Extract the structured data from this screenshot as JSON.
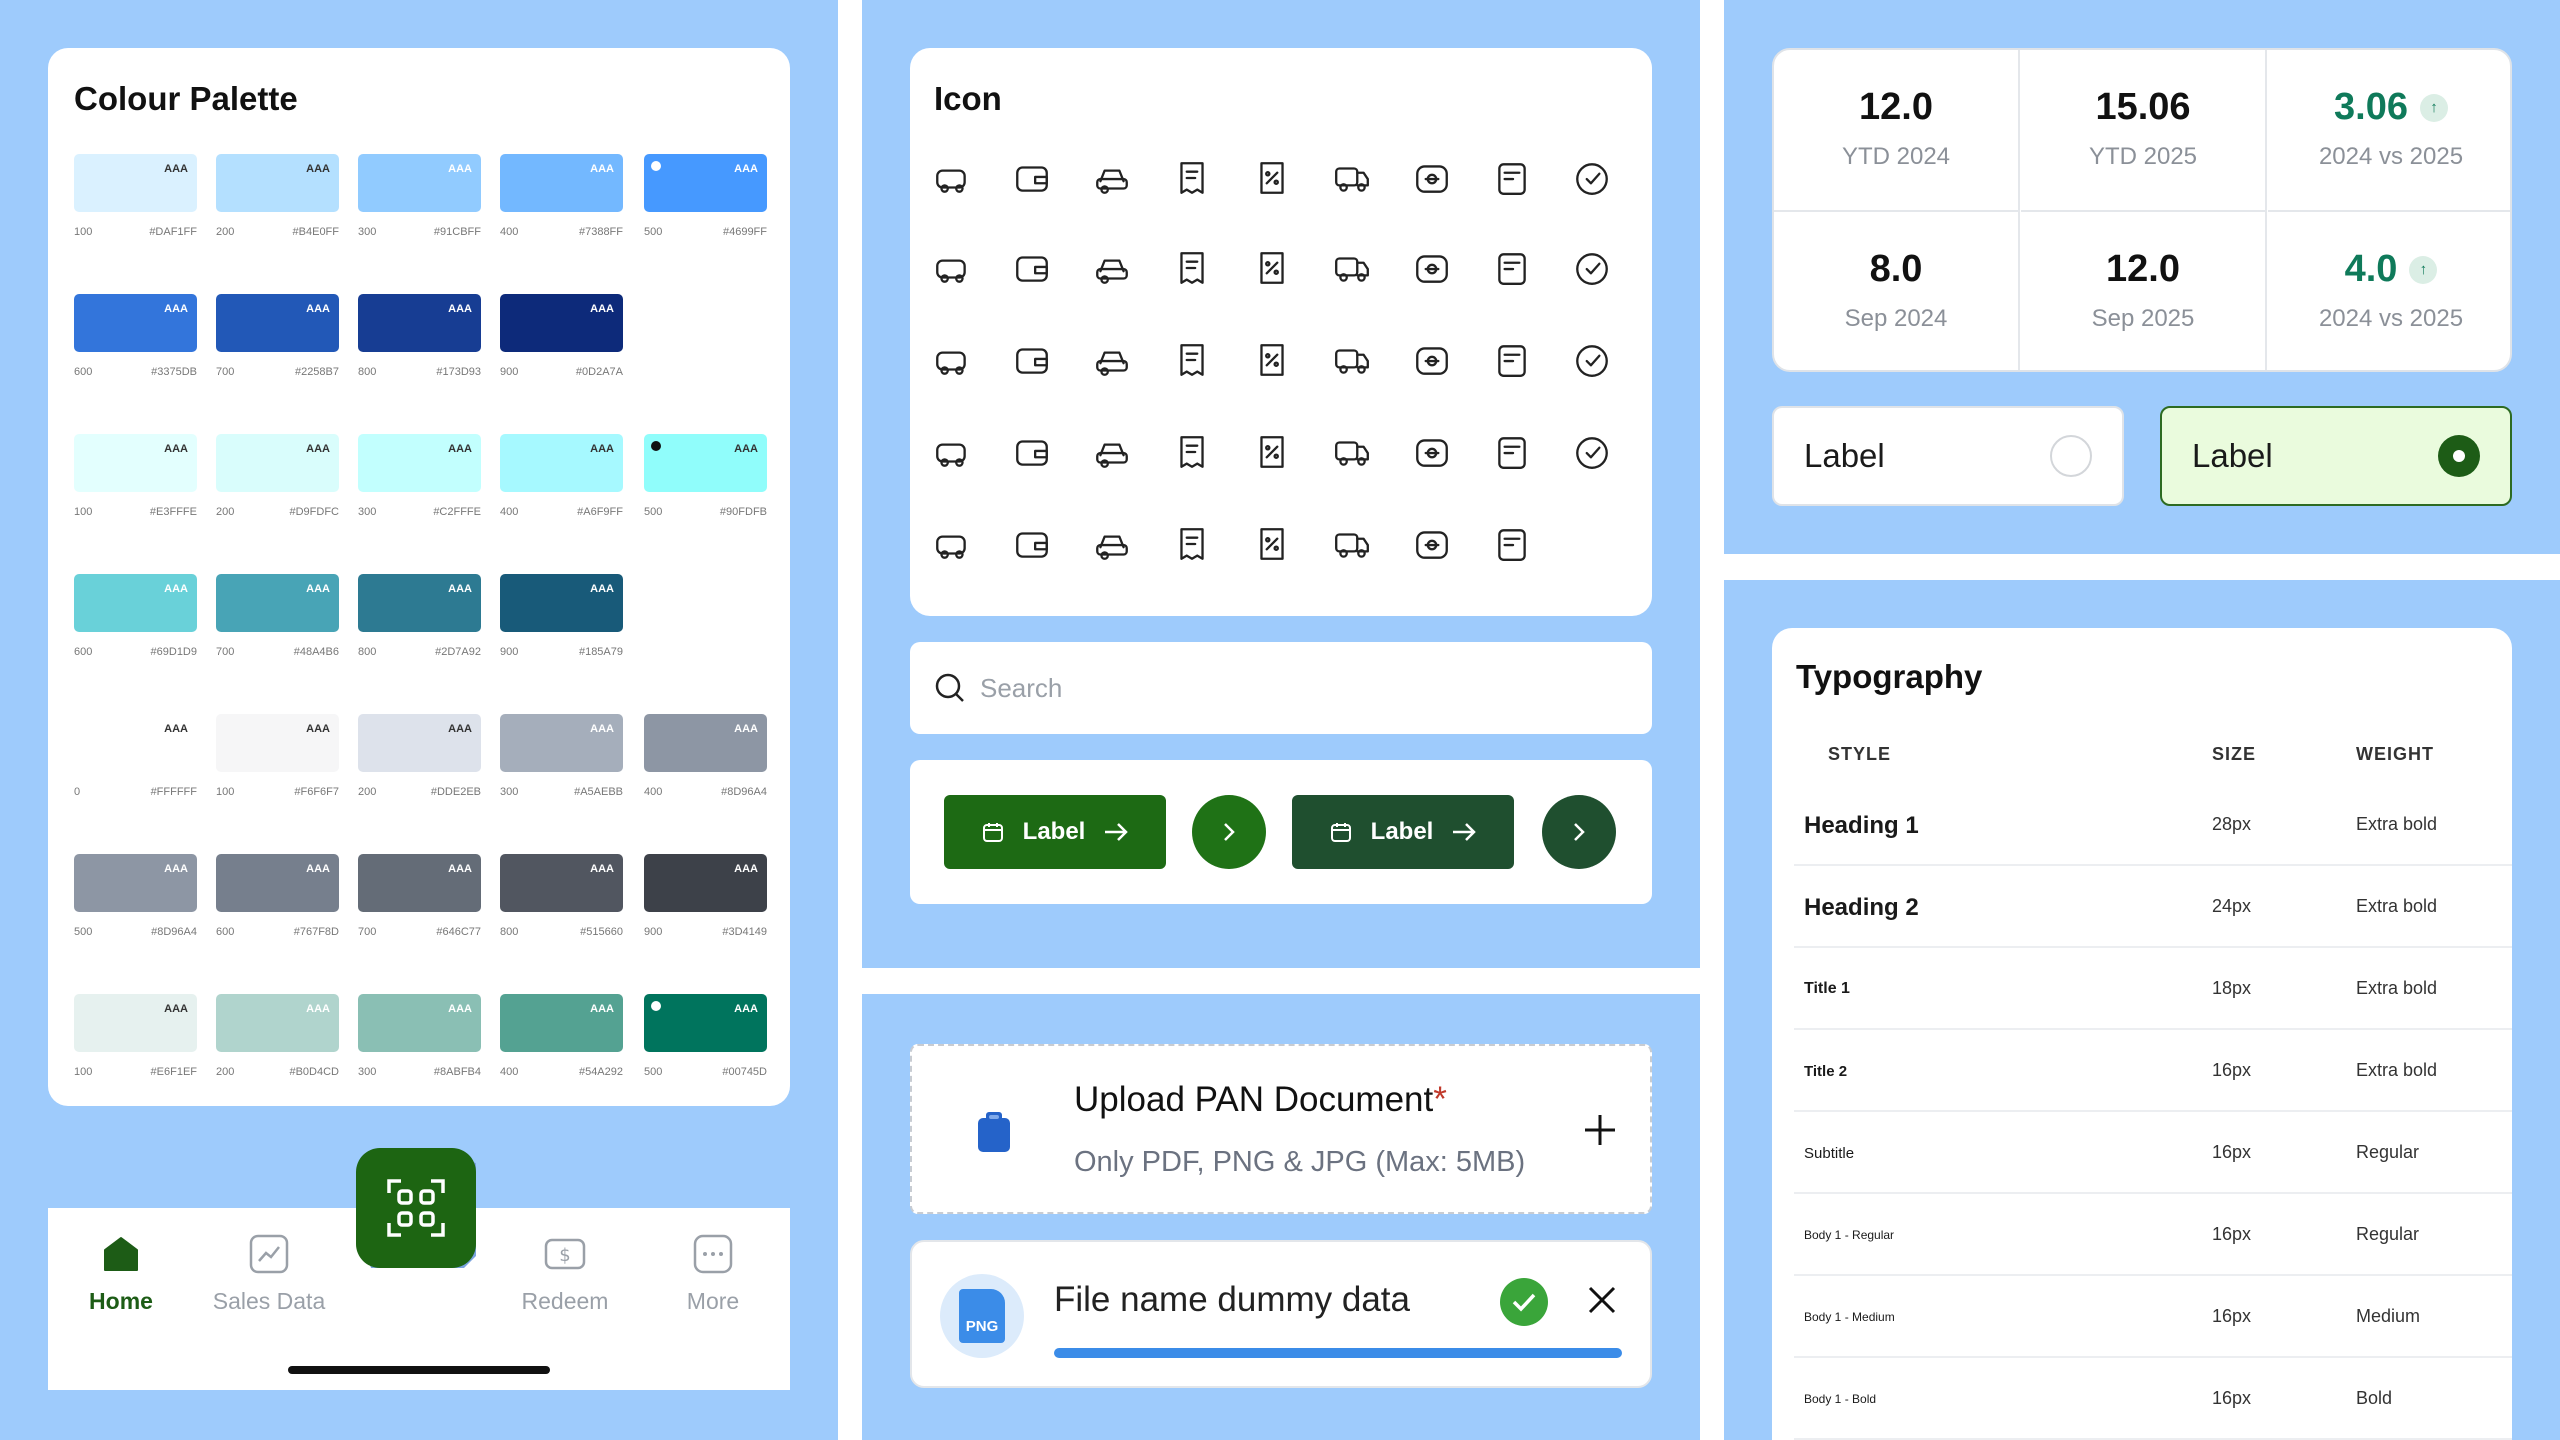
{
  "palette": {
    "title": "Colour Palette",
    "aaa": "AAA",
    "swatches": [
      {
        "n": "100",
        "h": "#DAF1FF",
        "c": "#DAF1FF",
        "row": 0,
        "col": 0
      },
      {
        "n": "200",
        "h": "#B4E0FF",
        "c": "#B4E0FF",
        "row": 0,
        "col": 1
      },
      {
        "n": "300",
        "h": "#91CBFF",
        "c": "#91CBFF",
        "row": 0,
        "col": 2
      },
      {
        "n": "400",
        "h": "#7388FF",
        "c": "#73B8FF",
        "row": 0,
        "col": 3
      },
      {
        "n": "500",
        "h": "#4699FF",
        "c": "#4699FF",
        "row": 0,
        "col": 4,
        "dot": true
      },
      {
        "n": "600",
        "h": "#3375DB",
        "c": "#3375DB",
        "row": 1,
        "col": 0
      },
      {
        "n": "700",
        "h": "#2258B7",
        "c": "#2258B7",
        "row": 1,
        "col": 1
      },
      {
        "n": "800",
        "h": "#173D93",
        "c": "#173D93",
        "row": 1,
        "col": 2
      },
      {
        "n": "900",
        "h": "#0D2A7A",
        "c": "#0D2A7A",
        "row": 1,
        "col": 3
      },
      {
        "n": "100",
        "h": "#E3FFFE",
        "c": "#E3FFFE",
        "row": 2,
        "col": 0
      },
      {
        "n": "200",
        "h": "#D9FDFC",
        "c": "#D9FDFC",
        "row": 2,
        "col": 1
      },
      {
        "n": "300",
        "h": "#C2FFFE",
        "c": "#C2FFFE",
        "row": 2,
        "col": 2
      },
      {
        "n": "400",
        "h": "#A6F9FF",
        "c": "#A6F9FF",
        "row": 2,
        "col": 3
      },
      {
        "n": "500",
        "h": "#90FDFB",
        "c": "#90FDFB",
        "row": 2,
        "col": 4,
        "dot": true
      },
      {
        "n": "600",
        "h": "#69D1D9",
        "c": "#69D1D9",
        "row": 3,
        "col": 0
      },
      {
        "n": "700",
        "h": "#48A4B6",
        "c": "#48A4B6",
        "row": 3,
        "col": 1
      },
      {
        "n": "800",
        "h": "#2D7A92",
        "c": "#2D7A92",
        "row": 3,
        "col": 2
      },
      {
        "n": "900",
        "h": "#185A79",
        "c": "#185A79",
        "row": 3,
        "col": 3
      },
      {
        "n": "0",
        "h": "#FFFFFF",
        "c": "#FFFFFF",
        "row": 4,
        "col": 0
      },
      {
        "n": "100",
        "h": "#F6F6F7",
        "c": "#F6F6F7",
        "row": 4,
        "col": 1
      },
      {
        "n": "200",
        "h": "#DDE2EB",
        "c": "#DDE2EB",
        "row": 4,
        "col": 2
      },
      {
        "n": "300",
        "h": "#A5AEBB",
        "c": "#A5AEBB",
        "row": 4,
        "col": 3
      },
      {
        "n": "400",
        "h": "#8D96A4",
        "c": "#8D96A4",
        "row": 4,
        "col": 4
      },
      {
        "n": "500",
        "h": "#8D96A4",
        "c": "#8D96A4",
        "row": 5,
        "col": 0
      },
      {
        "n": "600",
        "h": "#767F8D",
        "c": "#767F8D",
        "row": 5,
        "col": 1
      },
      {
        "n": "700",
        "h": "#646C77",
        "c": "#646C77",
        "row": 5,
        "col": 2
      },
      {
        "n": "800",
        "h": "#515660",
        "c": "#515660",
        "row": 5,
        "col": 3
      },
      {
        "n": "900",
        "h": "#3D4149",
        "c": "#3D4149",
        "row": 5,
        "col": 4
      },
      {
        "n": "100",
        "h": "#E6F1EF",
        "c": "#E6F1EF",
        "row": 6,
        "col": 0
      },
      {
        "n": "200",
        "h": "#B0D4CD",
        "c": "#B0D4CD",
        "row": 6,
        "col": 1
      },
      {
        "n": "300",
        "h": "#8ABFB4",
        "c": "#8ABFB4",
        "row": 6,
        "col": 2
      },
      {
        "n": "400",
        "h": "#54A292",
        "c": "#54A292",
        "row": 6,
        "col": 3
      },
      {
        "n": "500",
        "h": "#00745D",
        "c": "#00745D",
        "row": 6,
        "col": 4,
        "dot": true
      }
    ]
  },
  "nav": {
    "items": [
      {
        "label": "Home",
        "icon": "home-icon",
        "active": true
      },
      {
        "label": "Sales Data",
        "icon": "chart-icon",
        "active": false
      },
      {
        "label": "Redeem",
        "icon": "redeem-icon",
        "active": false
      },
      {
        "label": "More",
        "icon": "more-icon",
        "active": false
      }
    ],
    "fab_icon": "qr-scan-icon"
  },
  "icons": {
    "title": "Icon",
    "names": [
      "car-icon",
      "wallet-icon",
      "car-icon",
      "receipt-icon",
      "discount-tag-icon",
      "truck-icon",
      "truck-icon",
      "receipt-icon",
      "car-icon",
      "atm-icon",
      "truck-icon",
      "coins-icon",
      "receipt-add-icon",
      "cash-icon",
      "cash-icon",
      "card-icon",
      "coin-stack-icon",
      "truck-icon",
      "card-icon",
      "edit-doc-icon",
      "ticket-icon",
      "money-icon",
      "money-icon",
      "badge-percent-icon",
      "camera-icon",
      "wallet-icon",
      "search-doc-icon",
      "truck-icon",
      "card-check-icon",
      "money-icon",
      "camera-icon",
      "gift-icon",
      "exchange-icon",
      "percent-icon",
      "money-icon",
      "percent-circle-icon",
      "camera-icon",
      "tag-icon",
      "wallet-icon",
      "percent-icon",
      "car-icon",
      "chart-icon",
      "money-icon",
      "money-icon"
    ]
  },
  "search": {
    "placeholder": "Search"
  },
  "buttons": {
    "label1": "Label",
    "label2": "Label",
    "green": "#1d6a14",
    "dark": "#1f4f2f"
  },
  "upload": {
    "title": "Upload PAN Document",
    "required": "*",
    "subtitle": "Only PDF, PNG & JPG (Max: 5MB)"
  },
  "file": {
    "name": "File name dummy data",
    "badge": "PNG",
    "progress": 1.0
  },
  "stats": [
    {
      "v": "12.0",
      "s": "YTD 2024",
      "up": false
    },
    {
      "v": "15.06",
      "s": "YTD 2025",
      "up": false
    },
    {
      "v": "3.06",
      "s": "2024 vs 2025",
      "up": true
    },
    {
      "v": "8.0",
      "s": "Sep 2024",
      "up": false
    },
    {
      "v": "12.0",
      "s": "Sep 2025",
      "up": false
    },
    {
      "v": "4.0",
      "s": "2024 vs 2025",
      "up": true
    }
  ],
  "labels": {
    "unselected": "Label",
    "selected": "Label"
  },
  "typography": {
    "title": "Typography",
    "headers": {
      "style": "STYLE",
      "size": "SIZE",
      "weight": "WEIGHT"
    },
    "rows": [
      {
        "style": "Heading 1",
        "size": "28px",
        "weight": "Extra bold"
      },
      {
        "style": "Heading 2",
        "size": "24px",
        "weight": "Extra bold"
      },
      {
        "style": "Title 1",
        "size": "18px",
        "weight": "Extra bold"
      },
      {
        "style": "Title 2",
        "size": "16px",
        "weight": "Extra bold"
      },
      {
        "style": "Subtitle",
        "size": "16px",
        "weight": "Regular"
      },
      {
        "style": "Body 1 - Regular",
        "size": "16px",
        "weight": "Regular"
      },
      {
        "style": "Body 1 - Medium",
        "size": "16px",
        "weight": "Medium"
      },
      {
        "style": "Body 1 - Bold",
        "size": "16px",
        "weight": "Bold"
      }
    ]
  }
}
